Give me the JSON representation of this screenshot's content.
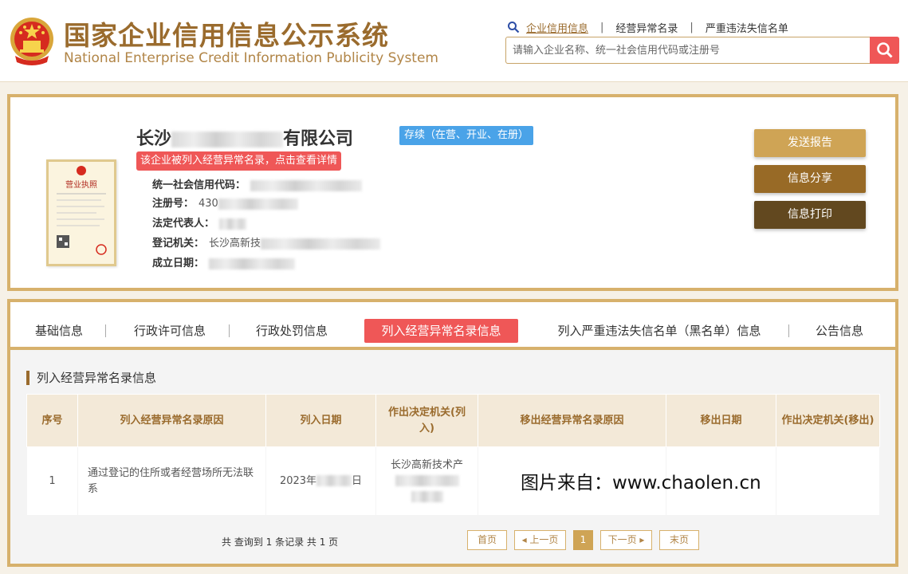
{
  "header": {
    "title_cn": "国家企业信用信息公示系统",
    "title_en": "National Enterprise Credit Information Publicity System",
    "nav": [
      "企业信用信息",
      "经营异常名录",
      "严重违法失信名单"
    ],
    "search_placeholder": "请输入企业名称、统一社会信用代码或注册号"
  },
  "company": {
    "name_prefix": "长沙",
    "name_suffix": "有限公司",
    "status": "存续（在营、开业、在册）",
    "alert": "该企业被列入经营异常名录，点击查看详情",
    "license_title": "营业执照",
    "fields": [
      {
        "label": "统一社会信用代码：",
        "value": ""
      },
      {
        "label": "注册号：",
        "value": "430"
      },
      {
        "label": "法定代表人：",
        "value": ""
      },
      {
        "label": "登记机关：",
        "value": "长沙高新技"
      },
      {
        "label": "成立日期：",
        "value": ""
      }
    ]
  },
  "actions": {
    "send": "发送报告",
    "share": "信息分享",
    "print": "信息打印"
  },
  "tabs": [
    "基础信息",
    "行政许可信息",
    "行政处罚信息",
    "列入经营异常名录信息",
    "列入严重违法失信名单（黑名单）信息",
    "公告信息"
  ],
  "section": {
    "title": "列入经营异常名录信息",
    "columns": [
      "序号",
      "列入经营异常名录原因",
      "列入日期",
      "作出决定机关(列入)",
      "移出经营异常名录原因",
      "移出日期",
      "作出决定机关(移出)"
    ],
    "rows": [
      {
        "no": "1",
        "reason": "通过登记的住所或者经营场所无法联系",
        "date_prefix": "2023年",
        "date_suffix": "日",
        "authority": "长沙高新技术产",
        "removal_reason": "",
        "removal_date": "",
        "removal_authority": ""
      }
    ]
  },
  "watermark": "图片来自：www.chaolen.cn",
  "pagination": {
    "info": "共 查询到 1 条记录 共 1 页",
    "first": "首页",
    "prev": "上一页",
    "current": "1",
    "next": "下一页",
    "last": "末页"
  },
  "colors": {
    "brand_gold": "#9a6b2d",
    "border_gold": "#d7b16c",
    "alert_red": "#ef5757",
    "status_blue": "#4aa3e8"
  }
}
